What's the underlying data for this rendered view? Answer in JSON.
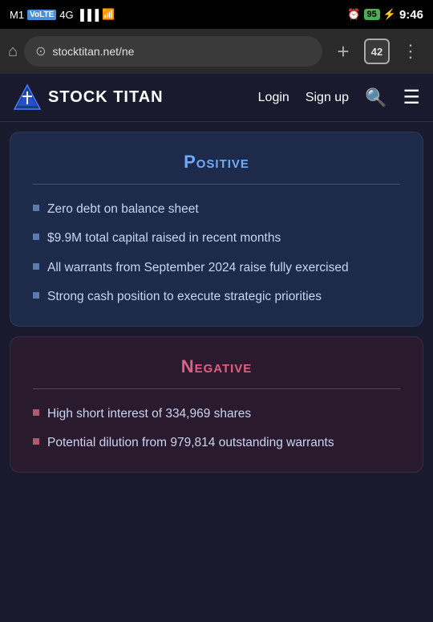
{
  "statusBar": {
    "carrier": "M1",
    "network": "VoLTE",
    "signal": "4G",
    "alarmIcon": "⏰",
    "batteryLevel": "95",
    "time": "9:46"
  },
  "browser": {
    "url": "stocktitan.net/ne",
    "tabCount": "42",
    "homeIcon": "⌂",
    "addTabIcon": "+",
    "menuIcon": "⋮"
  },
  "nav": {
    "brand": "STOCK TITAN",
    "loginLabel": "Login",
    "signupLabel": "Sign up"
  },
  "positive": {
    "title": "Positive",
    "bullets": [
      "Zero debt on balance sheet",
      "$9.9M total capital raised in recent months",
      "All warrants from September 2024 raise fully exercised",
      "Strong cash position to execute strategic priorities"
    ]
  },
  "negative": {
    "title": "Negative",
    "bullets": [
      "High short interest of 334,969 shares",
      "Potential dilution from 979,814 outstanding warrants"
    ]
  }
}
